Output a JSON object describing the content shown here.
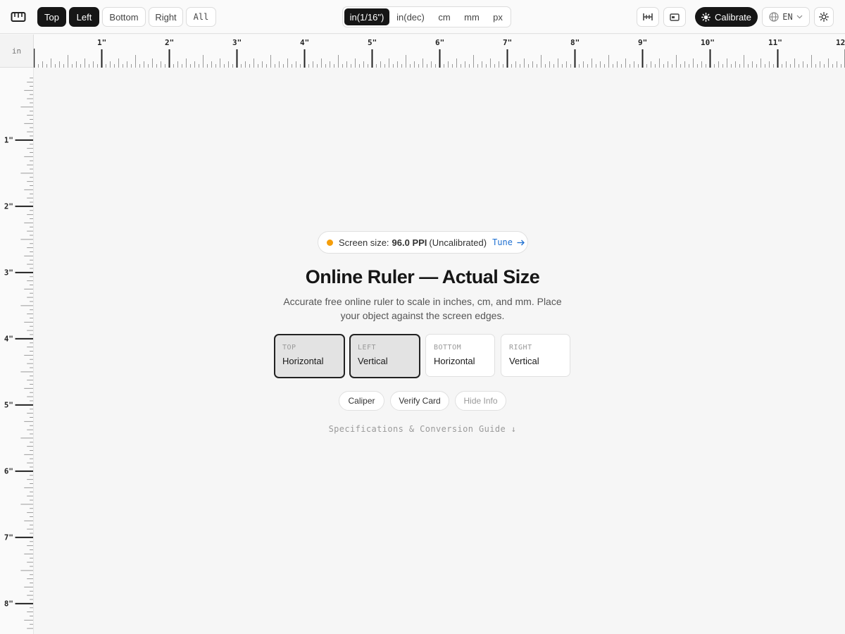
{
  "toolbar": {
    "logo_icon": "ruler-icon",
    "edges": [
      {
        "label": "Top",
        "active": true
      },
      {
        "label": "Left",
        "active": true
      },
      {
        "label": "Bottom",
        "active": false
      },
      {
        "label": "Right",
        "active": false
      },
      {
        "label": "All",
        "active": false
      }
    ],
    "units": [
      {
        "label": "in(1/16\")",
        "active": true
      },
      {
        "label": "in(dec)",
        "active": false
      },
      {
        "label": "cm",
        "active": false
      },
      {
        "label": "mm",
        "active": false
      },
      {
        "label": "px",
        "active": false
      }
    ],
    "caliper_icon": "caliper-icon",
    "card_icon": "card-icon",
    "calibrate_label": "Calibrate",
    "calibrate_icon": "sun-icon",
    "language": "EN",
    "language_icon": "globe-icon",
    "theme_icon": "sun-icon"
  },
  "ruler": {
    "unit_label": "in",
    "top_labels": [
      "1\"",
      "2\"",
      "3\"",
      "4\"",
      "5\"",
      "6\"",
      "7\"",
      "8\"",
      "9\"",
      "10\"",
      "11\"",
      "12\""
    ],
    "left_labels": [
      "1\"",
      "2\"",
      "3\"",
      "4\"",
      "5\"",
      "6\"",
      "7\"",
      "8\""
    ]
  },
  "info": {
    "screen_prefix": "Screen size:",
    "ppi": "96.0 PPI",
    "status": "(Uncalibrated)",
    "status_color": "#f59e0b",
    "tune_label": "Tune",
    "title": "Online Ruler — Actual Size",
    "subtitle": "Accurate free online ruler to scale in inches, cm, and mm. Place your object against the screen edges."
  },
  "cards": [
    {
      "kicker": "TOP",
      "label": "Horizontal",
      "active": true
    },
    {
      "kicker": "LEFT",
      "label": "Vertical",
      "active": true
    },
    {
      "kicker": "BOTTOM",
      "label": "Horizontal",
      "active": false
    },
    {
      "kicker": "RIGHT",
      "label": "Vertical",
      "active": false
    }
  ],
  "actions": {
    "caliper": "Caliper",
    "verify_card": "Verify Card",
    "hide_info": "Hide Info"
  },
  "spec_link": "Specifications & Conversion Guide ↓"
}
